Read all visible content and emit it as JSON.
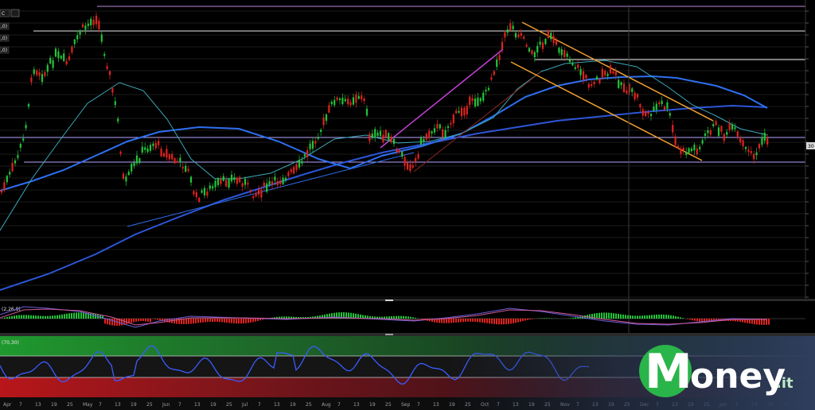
{
  "chart_data": {
    "type": "candlestick",
    "toolbar": {
      "tag_1": "C",
      "tag_2": ",0)",
      "tag_3": ",0)",
      "tag_4": ",0)"
    },
    "macd": {
      "label": "(2,26,9)"
    },
    "rsi": {
      "label": "(70,30)"
    },
    "price_marker": "30",
    "x_ticks": [
      "Apr",
      "7",
      "13",
      "19",
      "25",
      "May",
      "7",
      "13",
      "19",
      "25",
      "Jun",
      "7",
      "13",
      "19",
      "25",
      "Jul",
      "7",
      "13",
      "19",
      "25",
      "Aug",
      "7",
      "13",
      "19",
      "25",
      "Sep",
      "7",
      "13",
      "19",
      "25",
      "Oct",
      "7",
      "13",
      "19",
      "25",
      "Nov",
      "7",
      "13",
      "19",
      "25",
      "Dec",
      "7",
      "13",
      "19",
      "25",
      "Jan",
      "7",
      "13",
      "19",
      "25"
    ]
  },
  "branding": {
    "logo_main": "oney",
    "logo_suffix": ".it",
    "logo_letter": "M"
  },
  "colors": {
    "bull": "#22c43a",
    "bear": "#e0231e",
    "ma_fast": "#3aa8b8",
    "ma_mid": "#2e6ff0",
    "ma_slow": "#2d56d8",
    "h_line_white": "#e8e8e8",
    "h_line_lavender": "#b9a6ff",
    "trend_magenta": "#c640d8",
    "channel_orange": "#f0a030",
    "rsi_green": "#1f9a2e",
    "rsi_red": "#b8161a",
    "rsi_line": "#3a5cff",
    "logo_green": "#2ab54a"
  }
}
